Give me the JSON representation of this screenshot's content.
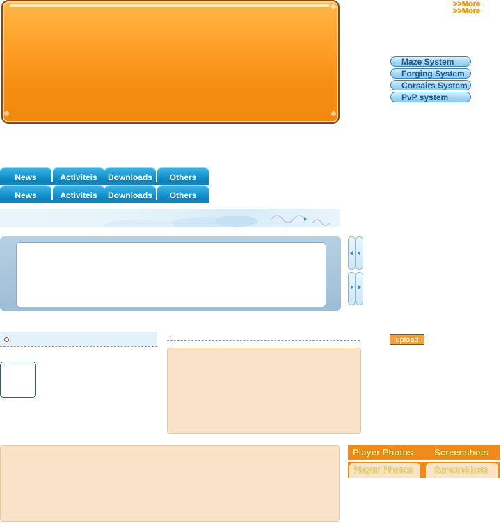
{
  "banner": {},
  "more_links": [
    ">>More",
    ">>More"
  ],
  "systems": [
    "Maze System",
    "Forging System",
    "Corsairs System",
    "PvP system"
  ],
  "tabs_row1": [
    "News",
    "Activiteis",
    "Downloads",
    "Others"
  ],
  "tabs_row2": [
    "News",
    "Activiteis",
    "Downloads",
    "Others"
  ],
  "comment_dot": ".",
  "upload_label": "upload",
  "photo_tabs_row1": [
    "Player Photos",
    "Screenshots"
  ],
  "photo_tabs_row2": [
    "Player Photos",
    "Screenshots"
  ],
  "colors": {
    "banner": "#f5a020",
    "tab_blue": "#1492cc",
    "system_button": "#a6d6f5",
    "peach": "#f8e3c8",
    "photo_bar": "#f08a1a"
  }
}
